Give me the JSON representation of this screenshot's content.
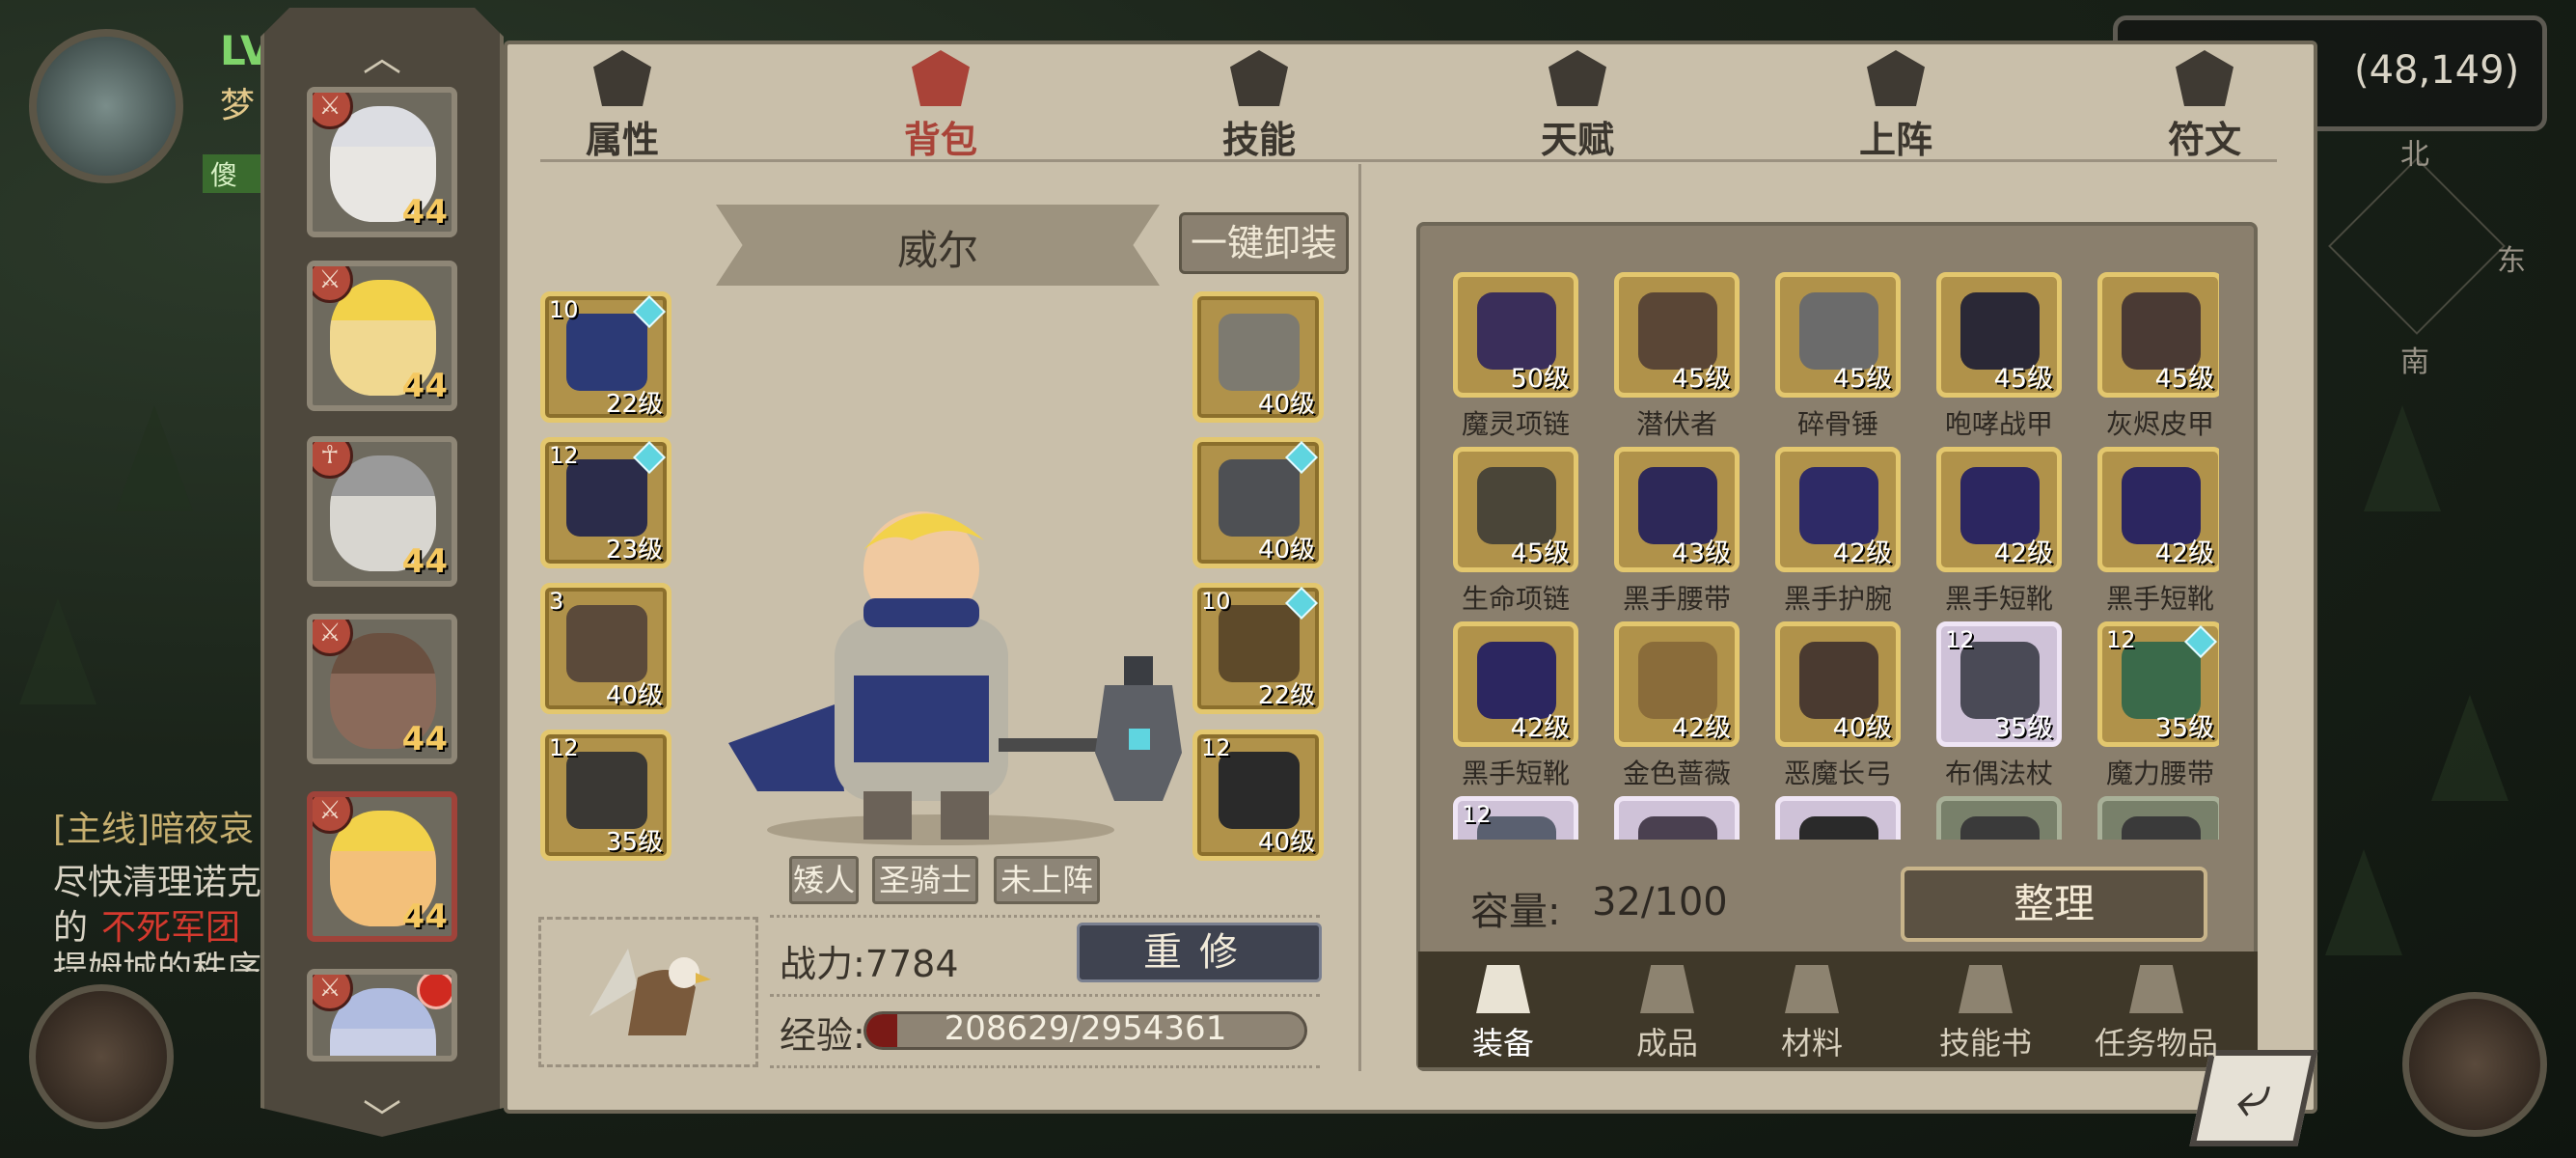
{
  "hud": {
    "level_prefix": "LV",
    "name_prefix": "梦",
    "tag": "傻",
    "quest_lines": [
      "[主线]暗夜哀",
      "尽快清理诺克",
      "的",
      "不死军团",
      "提姆城的秩序"
    ],
    "coordinates": "(48,149)",
    "compass": {
      "north": "北",
      "south": "南",
      "east": "东"
    }
  },
  "roster": [
    {
      "level": "44",
      "badge": "⚔",
      "face": "#e8e6e2",
      "hair": "#dcdde2"
    },
    {
      "level": "44",
      "badge": "⚔",
      "face": "#f0d890",
      "hair": "#f2d24a"
    },
    {
      "level": "44",
      "badge": "☥",
      "face": "#d8d6d0",
      "hair": "#9a9a9a"
    },
    {
      "level": "44",
      "badge": "⚔",
      "face": "#8a6a5a",
      "hair": "#6a5040"
    },
    {
      "level": "44",
      "badge": "⚔",
      "face": "#f3c07a",
      "hair": "#f2d24a"
    },
    {
      "level": "",
      "badge": "⚔",
      "face": "#c9cfe6",
      "hair": "#b0bce0"
    }
  ],
  "tabs": [
    {
      "label": "属性",
      "icon": "flame-icon"
    },
    {
      "label": "背包",
      "icon": "fist-icon"
    },
    {
      "label": "技能",
      "icon": "book-icon"
    },
    {
      "label": "天赋",
      "icon": "eye-icon"
    },
    {
      "label": "上阵",
      "icon": "crossed-swords-icon"
    },
    {
      "label": "符文",
      "icon": "rune-icon"
    }
  ],
  "active_tab": "背包",
  "character": {
    "name": "威尔",
    "unequip_label": "一键卸装",
    "tags": [
      "矮人",
      "圣骑士",
      "未上阵"
    ],
    "power_label": "战力:7784",
    "reforge_label": "重修",
    "exp_label": "经验:",
    "exp_text": "208629/2954361",
    "exp_fraction": 0.0706
  },
  "left_slots": [
    {
      "count": "10",
      "level": "22级",
      "gem": true,
      "color": "#2c3a76"
    },
    {
      "count": "12",
      "level": "23级",
      "gem": true,
      "color": "#2b2c4a"
    },
    {
      "count": "3",
      "level": "40级",
      "gem": false,
      "color": "#5b4a3a"
    },
    {
      "count": "12",
      "level": "35级",
      "gem": false,
      "color": "#3a3834"
    }
  ],
  "right_slots": [
    {
      "count": "",
      "level": "40级",
      "gem": false,
      "color": "#7d7a70"
    },
    {
      "count": "",
      "level": "40级",
      "gem": true,
      "color": "#4e5054"
    },
    {
      "count": "10",
      "level": "22级",
      "gem": true,
      "color": "#5e4a2a"
    },
    {
      "count": "12",
      "level": "40级",
      "gem": false,
      "color": "#2a2a2a"
    }
  ],
  "inventory": {
    "items": [
      {
        "name": "魔灵项链",
        "level": "50级",
        "count": "",
        "style": "gold",
        "gem": false,
        "color": "#3a2e5a"
      },
      {
        "name": "潜伏者",
        "level": "45级",
        "count": "",
        "style": "gold",
        "gem": false,
        "color": "#5a4636"
      },
      {
        "name": "碎骨锤",
        "level": "45级",
        "count": "",
        "style": "gold",
        "gem": false,
        "color": "#6b6b6b"
      },
      {
        "name": "咆哮战甲",
        "level": "45级",
        "count": "",
        "style": "gold",
        "gem": false,
        "color": "#2a2836"
      },
      {
        "name": "灰烬皮甲",
        "level": "45级",
        "count": "",
        "style": "gold",
        "gem": false,
        "color": "#4a3a34"
      },
      {
        "name": "生命项链",
        "level": "45级",
        "count": "",
        "style": "gold",
        "gem": false,
        "color": "#4a4538"
      },
      {
        "name": "黑手腰带",
        "level": "43级",
        "count": "",
        "style": "gold",
        "gem": false,
        "color": "#2d2858"
      },
      {
        "name": "黑手护腕",
        "level": "42级",
        "count": "",
        "style": "gold",
        "gem": false,
        "color": "#2e2a66"
      },
      {
        "name": "黑手短靴",
        "level": "42级",
        "count": "",
        "style": "gold",
        "gem": false,
        "color": "#2c2660"
      },
      {
        "name": "黑手短靴",
        "level": "42级",
        "count": "",
        "style": "gold",
        "gem": false,
        "color": "#2c2660"
      },
      {
        "name": "黑手短靴",
        "level": "42级",
        "count": "",
        "style": "gold",
        "gem": false,
        "color": "#2c2660"
      },
      {
        "name": "金色蔷薇",
        "level": "42级",
        "count": "",
        "style": "gold",
        "gem": false,
        "color": "#8a6c3a"
      },
      {
        "name": "恶魔长弓",
        "level": "40级",
        "count": "",
        "style": "gold",
        "gem": false,
        "color": "#4a3a30"
      },
      {
        "name": "布偶法杖",
        "level": "35级",
        "count": "12",
        "style": "purple",
        "gem": false,
        "color": "#4a4a56"
      },
      {
        "name": "魔力腰带",
        "level": "35级",
        "count": "12",
        "style": "gold",
        "gem": true,
        "color": "#3a6a4a"
      },
      {
        "name": "",
        "level": "",
        "count": "12",
        "style": "purple",
        "gem": false,
        "color": "#5a6070"
      },
      {
        "name": "",
        "level": "",
        "count": "",
        "style": "purple",
        "gem": false,
        "color": "#4a4050"
      },
      {
        "name": "",
        "level": "",
        "count": "",
        "style": "purple",
        "gem": false,
        "color": "#2a2a2a"
      },
      {
        "name": "",
        "level": "",
        "count": "",
        "style": "green",
        "gem": false,
        "color": "#3a3a3a"
      },
      {
        "name": "",
        "level": "",
        "count": "",
        "style": "green",
        "gem": false,
        "color": "#3a3a3a"
      }
    ],
    "capacity_label": "容量:",
    "capacity_value": "32/100",
    "sort_label": "整理"
  },
  "categories": [
    {
      "label": "装备",
      "icon": "equipment-icon",
      "active": true
    },
    {
      "label": "成品",
      "icon": "bag-icon",
      "active": false
    },
    {
      "label": "材料",
      "icon": "ore-icon",
      "active": false
    },
    {
      "label": "技能书",
      "icon": "scroll-icon",
      "active": false
    },
    {
      "label": "任务物品",
      "icon": "quest-scroll-icon",
      "active": false
    }
  ],
  "colors": {
    "panel": "#c9bfaa",
    "gold_frame": "#e3c76e",
    "accent_red": "#a94338",
    "exp_fill": "#7a1a16"
  }
}
